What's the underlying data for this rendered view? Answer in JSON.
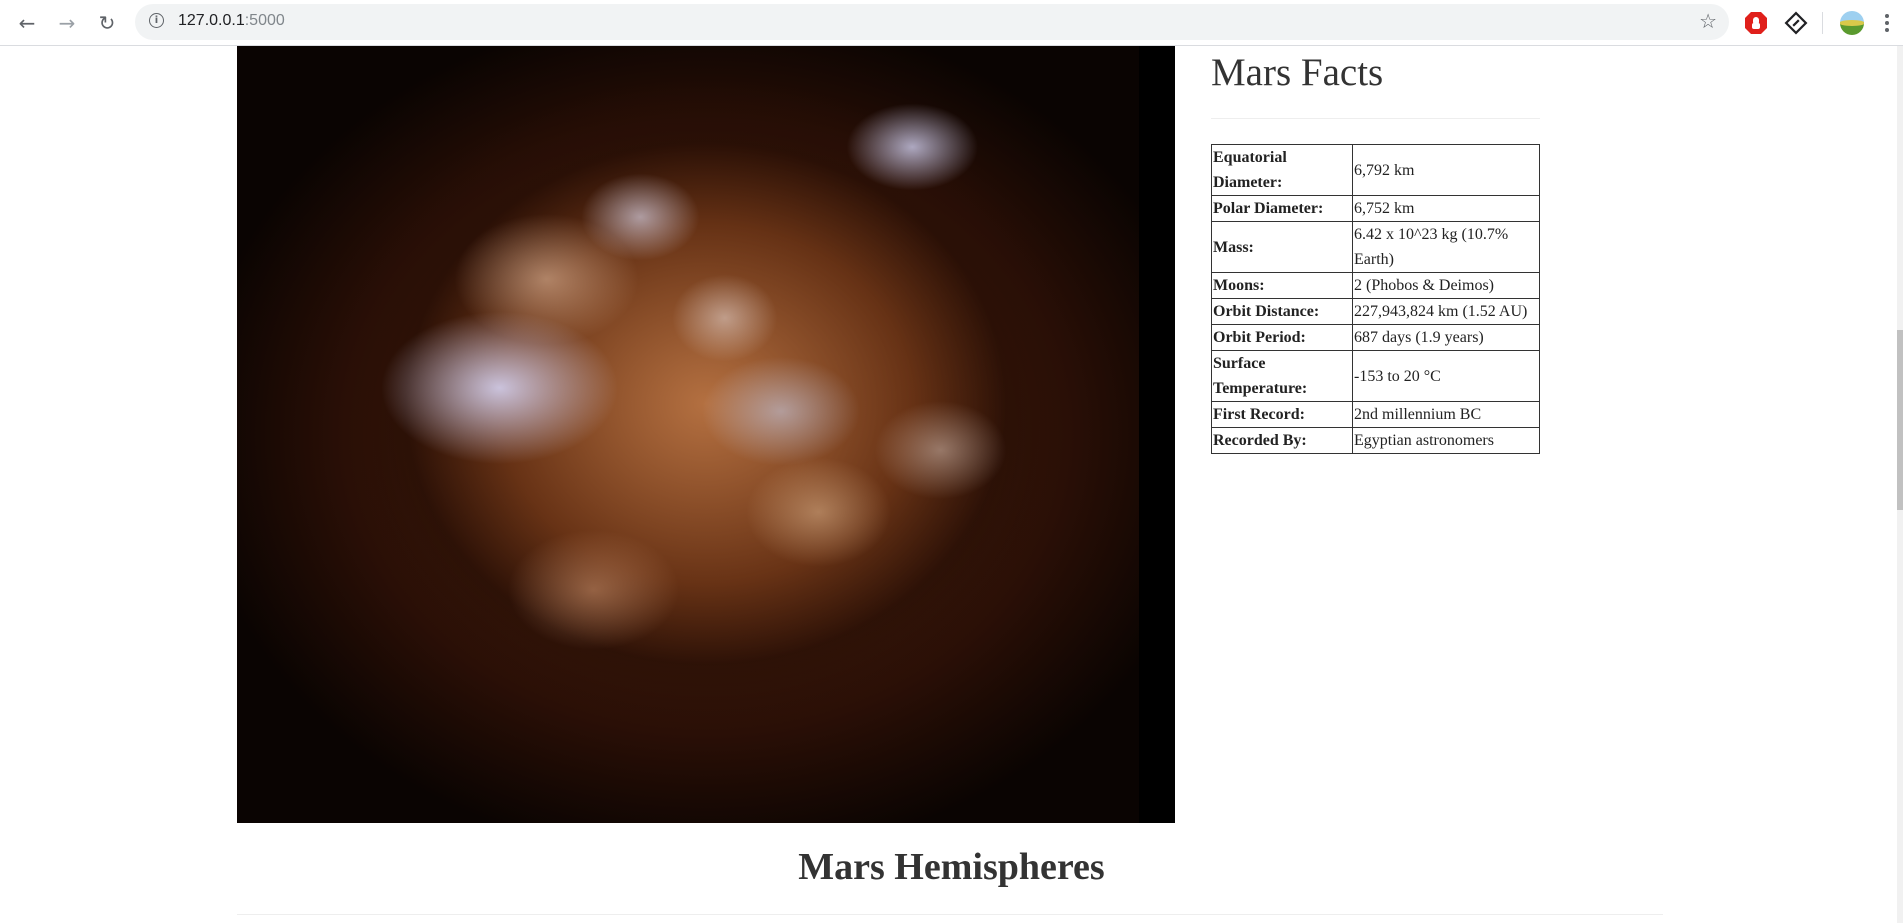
{
  "browser": {
    "url_host": "127.0.0.1",
    "url_port": ":5000",
    "icons": [
      "back-arrow-icon",
      "forward-arrow-icon",
      "reload-icon",
      "info-icon",
      "star-icon",
      "extension-stop-icon",
      "extension-diamond-icon",
      "profile-avatar-icon",
      "menu-dots-icon"
    ]
  },
  "page": {
    "facts_title": "Mars Facts",
    "facts": [
      {
        "label": "Equatorial Diameter:",
        "value": "6,792 km"
      },
      {
        "label": "Polar Diameter:",
        "value": "6,752 km"
      },
      {
        "label": "Mass:",
        "value": "6.42 x 10^23 kg (10.7% Earth)"
      },
      {
        "label": "Moons:",
        "value": "2 (Phobos & Deimos)"
      },
      {
        "label": "Orbit Distance:",
        "value": "227,943,824 km (1.52 AU)"
      },
      {
        "label": "Orbit Period:",
        "value": "687 days (1.9 years)"
      },
      {
        "label": "Surface Temperature:",
        "value": "-153 to 20 °C"
      },
      {
        "label": "First Record:",
        "value": "2nd millennium BC"
      },
      {
        "label": "Recorded By:",
        "value": "Egyptian astronomers"
      }
    ],
    "hemispheres_title": "Mars Hemispheres"
  }
}
